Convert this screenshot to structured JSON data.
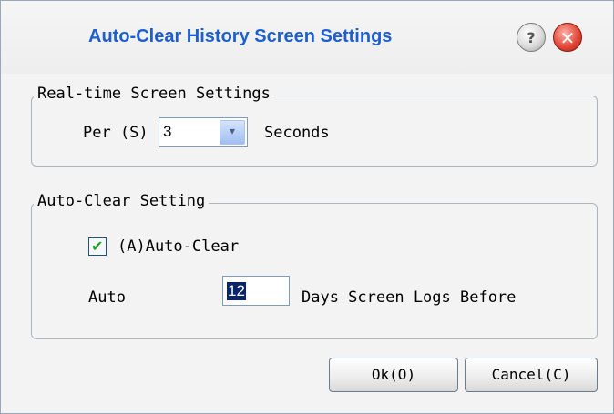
{
  "window": {
    "title": "Auto-Clear History Screen Settings",
    "help_glyph": "?",
    "close_glyph": "✕"
  },
  "realtime_group": {
    "legend": "Real-time Screen Settings",
    "per_label": "Per (S)",
    "interval_value": "3",
    "dropdown_icon": "chevron-down-icon",
    "dropdown_glyph": "▾",
    "unit_label": "Seconds"
  },
  "autoclear_group": {
    "legend": "Auto-Clear Setting",
    "checkbox_label": "(A)Auto-Clear",
    "checkbox_checked": true,
    "check_glyph": "✔",
    "auto_label": "Auto",
    "days_value": "12",
    "days_suffix": "Days Screen Logs Before"
  },
  "buttons": {
    "ok": "Ok(O)",
    "cancel": "Cancel(C)"
  },
  "colors": {
    "title": "#1d5fcf",
    "selection": "#0a246a",
    "check": "#21a121",
    "close": "#e44a3a"
  }
}
